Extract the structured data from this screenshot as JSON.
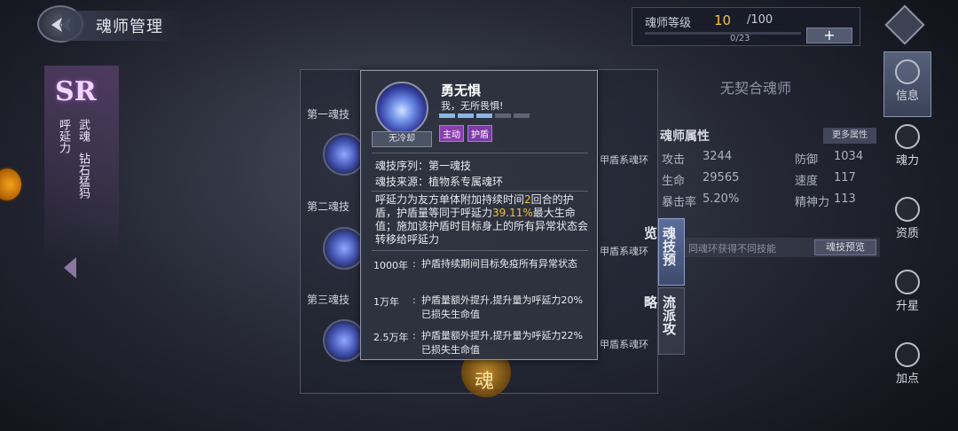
{
  "header": {
    "title": "魂师管理",
    "level_label": "魂师等级",
    "level_current": "10",
    "level_max": "/100",
    "level_sub": "0/23",
    "plus": "+"
  },
  "left": {
    "rarity": "SR",
    "col_name": "呼延力",
    "col_title1": "武魂",
    "col_title2": "钻石猛犸"
  },
  "skill_list": {
    "labels": [
      "第一魂技",
      "第二魂技",
      "第三魂技"
    ],
    "ring_tags": [
      "甲盾系魂环",
      "甲盾系魂环",
      "甲盾系魂环"
    ]
  },
  "right_info": {
    "no_contract": "无契合魂师",
    "attr_title": "魂师属性",
    "more_attr": "更多属性",
    "stats": [
      {
        "label": "攻击",
        "value": "3244"
      },
      {
        "label": "防御",
        "value": "1034"
      },
      {
        "label": "生命",
        "value": "29565"
      },
      {
        "label": "速度",
        "value": "117"
      },
      {
        "label": "暴击率",
        "value": "5.20%"
      },
      {
        "label": "精神力",
        "value": "113"
      }
    ],
    "preview_hint": "同魂环获得不同技能",
    "preview_btn": "魂技预览",
    "tab_preview": "魂技预览",
    "tab_style": "流派攻略"
  },
  "right_nav": [
    {
      "label": "信息",
      "icon": "info-icon"
    },
    {
      "label": "魂力",
      "icon": "soul-power-icon"
    },
    {
      "label": "资质",
      "icon": "aptitude-icon"
    },
    {
      "label": "升星",
      "icon": "star-up-icon"
    },
    {
      "label": "加点",
      "icon": "add-point-icon"
    }
  ],
  "emblem": "魂",
  "tooltip": {
    "name": "勇无惧",
    "quote": "我，无所畏惧!",
    "cooldown": "无冷却",
    "pips_on": 3,
    "pips_total": 5,
    "tags": [
      "主动",
      "护盾"
    ],
    "seq": "魂技序列：第一魂技",
    "source": "魂技来源：植物系专属魂环",
    "desc": {
      "p1": "呼延力为友方单体附加持续时间",
      "n1": "2",
      "p2": "回合的护盾，护盾量等同于呼延力",
      "n2": "39.11%",
      "p3": "最大生命值；施加该护盾时目标身上的所有异常状态会转移给呼延力"
    },
    "upgrades": [
      {
        "label": "1000年",
        "colon": ":",
        "text": "护盾持续期间目标免疫所有异常状态"
      },
      {
        "label": "1万年",
        "colon": ":",
        "text": "护盾量额外提升,提升量为呼延力20%已损失生命值"
      },
      {
        "label": "2.5万年",
        "colon": ":",
        "text": "护盾量额外提升,提升量为呼延力22%已损失生命值"
      }
    ]
  }
}
